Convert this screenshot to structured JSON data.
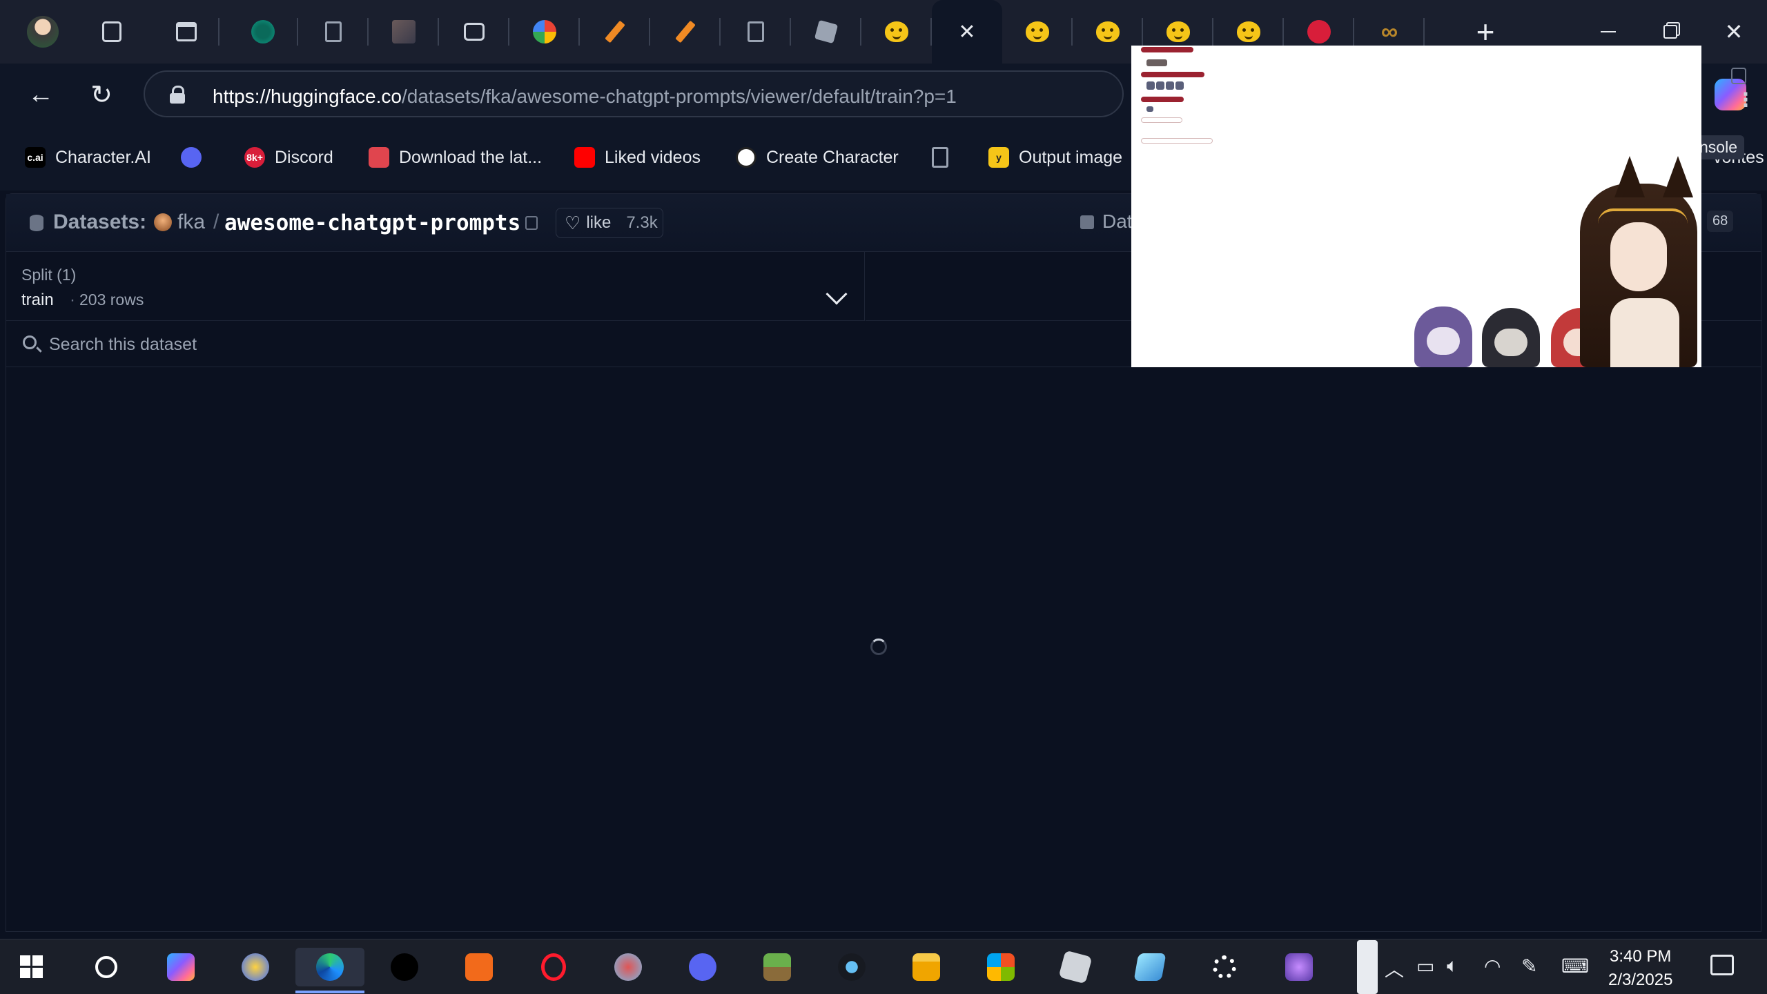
{
  "browser": {
    "url_host": "https://huggingface.co",
    "url_path": "/datasets/fka/awesome-chatgpt-prompts/viewer/default/train?p=1",
    "tabs": [
      {
        "icon": "vertex-icon"
      },
      {
        "icon": "document-icon"
      },
      {
        "icon": "image-icon"
      },
      {
        "icon": "image-viewer-icon"
      },
      {
        "icon": "pinwheel-icon"
      },
      {
        "icon": "pencil-icon"
      },
      {
        "icon": "pencil-icon"
      },
      {
        "icon": "document-icon"
      },
      {
        "icon": "roblox-icon"
      },
      {
        "icon": "huggingface-icon"
      },
      {
        "icon": "close-icon",
        "active": true
      },
      {
        "icon": "huggingface-icon"
      },
      {
        "icon": "huggingface-icon"
      },
      {
        "icon": "huggingface-icon"
      },
      {
        "icon": "huggingface-icon"
      },
      {
        "icon": "8k-icon"
      },
      {
        "icon": "infinity-icon"
      }
    ],
    "new_tab_label": "+",
    "tab_close_label": "✕",
    "bookmarks": [
      {
        "label": "Character.AI",
        "icon": "characterai-icon",
        "icon_text": "c.ai",
        "color": "#000000"
      },
      {
        "label": "",
        "icon": "discord-icon",
        "color": "#5865f2"
      },
      {
        "label": "Discord",
        "icon": "8k-icon",
        "icon_text": "8k+",
        "color": "#d81e3a"
      },
      {
        "label": "Download the lat...",
        "icon": "store-icon",
        "color": "#e0454e"
      },
      {
        "label": "Liked videos",
        "icon": "youtube-icon",
        "color": "#ff0000"
      },
      {
        "label": "Create Character",
        "icon": "openai-icon",
        "color": "#ffffff"
      },
      {
        "label": "",
        "icon": "document-icon",
        "color": "#9aa3b2"
      },
      {
        "label": "Output image",
        "icon": "y-icon",
        "icon_text": "y",
        "color": "#f5c518"
      }
    ],
    "bookmarks_overflow": "vorites"
  },
  "dataset": {
    "prefix": "Datasets:",
    "owner": "fka",
    "slash": "/",
    "name": "awesome-chatgpt-prompts",
    "like_label": "like",
    "like_count": "7.3k",
    "data_tab_partial": "Data",
    "badge_partial": "68",
    "split_label": "Split (1)",
    "split_value": "train",
    "split_dot": "·",
    "split_rows": "203 rows",
    "search_placeholder": "Search this dataset",
    "console_partial": "nsole"
  },
  "taskbar": {
    "apps": [
      "start-icon",
      "search-icon",
      "copilot-icon",
      "game-icon",
      "edge-icon",
      "tiktok-icon",
      "touch-app-icon",
      "opera-icon",
      "paint-icon",
      "discord-icon",
      "minecraft-icon",
      "steam-icon",
      "file-explorer-icon",
      "microsoft-store-icon",
      "roblox-icon",
      "notes-icon",
      "settings-icon",
      "anime-app-icon"
    ],
    "time": "3:40 PM",
    "date": "2/3/2025"
  },
  "colors": {
    "accent": "#7aa2ff",
    "page_bg": "#0b1120",
    "huggingface_yellow": "#f5c518"
  }
}
